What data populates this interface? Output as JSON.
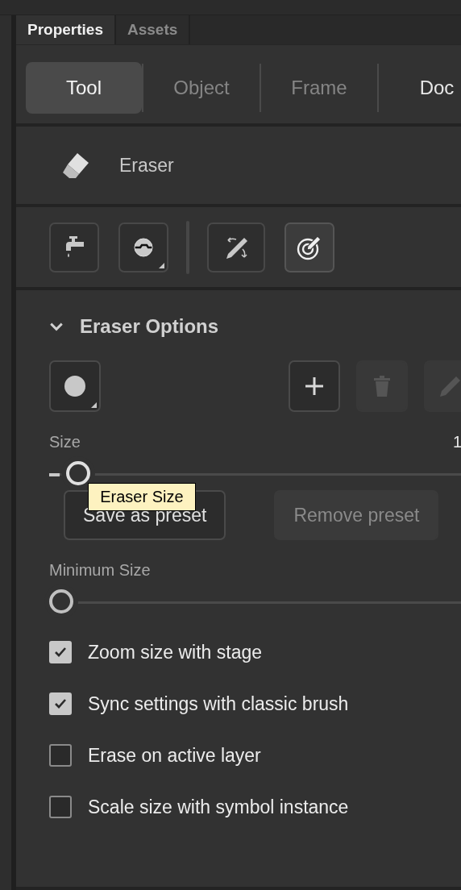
{
  "panel_tabs": [
    {
      "label": "Properties",
      "selected": true
    },
    {
      "label": "Assets",
      "selected": false
    }
  ],
  "segments": [
    {
      "label": "Tool",
      "selected": true,
      "disabled": false
    },
    {
      "label": "Object",
      "selected": false,
      "disabled": true
    },
    {
      "label": "Frame",
      "selected": false,
      "disabled": true
    },
    {
      "label": "Doc",
      "selected": false,
      "disabled": false
    }
  ],
  "tool": {
    "name": "Eraser"
  },
  "tool_modes": [
    {
      "kind": "faucet",
      "selected": false
    },
    {
      "kind": "brush-mode",
      "selected": false,
      "menu": true
    },
    {
      "kind": "separator"
    },
    {
      "kind": "pencil-arrows",
      "selected": false
    },
    {
      "kind": "target-pencil",
      "selected": true
    }
  ],
  "section": {
    "title": "Eraser Options",
    "expanded": true
  },
  "preset_buttons": [
    {
      "kind": "shape",
      "disabled": false,
      "menu": true
    },
    {
      "kind": "add",
      "disabled": false
    },
    {
      "kind": "delete",
      "disabled": true
    },
    {
      "kind": "edit",
      "disabled": true
    }
  ],
  "size": {
    "label": "Size",
    "value": "1",
    "level": 0.04,
    "tooltip": "Eraser Size"
  },
  "preset_actions": [
    {
      "label": "Save as preset",
      "disabled": false
    },
    {
      "label": "Remove preset",
      "disabled": true
    }
  ],
  "minimum_size": {
    "label": "Minimum Size",
    "level": 0
  },
  "options": [
    {
      "label": "Zoom size with stage",
      "checked": true
    },
    {
      "label": "Sync settings with classic brush",
      "checked": true
    },
    {
      "label": "Erase on active layer",
      "checked": false
    },
    {
      "label": "Scale size with symbol instance",
      "checked": false
    }
  ]
}
